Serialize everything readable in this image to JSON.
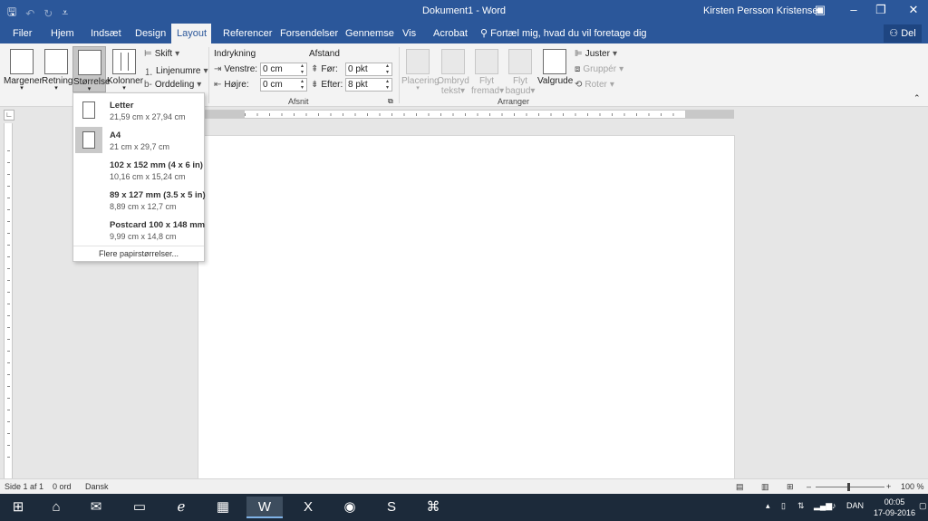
{
  "window": {
    "title": "Dokument1 - Word",
    "user": "Kirsten Persson Kristensen",
    "qat": {
      "save_icon": "save-icon",
      "undo_icon": "undo-icon",
      "redo_icon": "redo-icon",
      "customize_icon": "customize-icon"
    }
  },
  "tabs": [
    "Filer",
    "Hjem",
    "Indsæt",
    "Design",
    "Layout",
    "Referencer",
    "Forsendelser",
    "Gennemse",
    "Vis",
    "Acrobat"
  ],
  "active_tab": "Layout",
  "tell_me": "Fortæl mig, hvad du vil foretage dig",
  "share_label": "Del",
  "ribbon": {
    "page_setup": {
      "margins": "Margener",
      "orientation": "Retning",
      "size": "Størrelse",
      "columns": "Kolonner",
      "breaks": "Skift",
      "line_numbers": "Linjenumre",
      "hyphenation": "Orddeling"
    },
    "paragraph": {
      "label": "Afsnit",
      "indent": "Indrykning",
      "spacing": "Afstand",
      "left_label": "Venstre:",
      "left_value": "0 cm",
      "right_label": "Højre:",
      "right_value": "0 cm",
      "before_label": "Før:",
      "before_value": "0 pkt",
      "after_label": "Efter:",
      "after_value": "8 pkt"
    },
    "arrange": {
      "label": "Arranger",
      "position": "Placering",
      "wrap_text_1": "Ombryd",
      "wrap_text_2": "tekst",
      "bring_forward_1": "Flyt",
      "bring_forward_2": "fremad",
      "send_backward_1": "Flyt",
      "send_backward_2": "bagud",
      "selection_pane": "Valgrude",
      "align": "Juster",
      "group": "Gruppér",
      "rotate": "Roter"
    }
  },
  "size_menu": {
    "items": [
      {
        "name": "Letter",
        "dims": "21,59 cm x 27,94 cm"
      },
      {
        "name": "A4",
        "dims": "21 cm x 29,7 cm"
      },
      {
        "name": "102 x 152 mm (4 x 6 in)",
        "dims": "10,16 cm x 15,24 cm"
      },
      {
        "name": "89 x 127 mm (3.5 x 5 in)",
        "dims": "8,89 cm x 12,7 cm"
      },
      {
        "name": "Postcard 100 x 148 mm",
        "dims": "9,99 cm x 14,8 cm"
      }
    ],
    "selected_index": 1,
    "more": "Flere papirstørrelser..."
  },
  "ruler_numbers": [
    "1",
    "2",
    "1",
    "2",
    "3",
    "4",
    "5",
    "6",
    "7",
    "8",
    "9",
    "10",
    "11",
    "12",
    "13",
    "14",
    "15",
    "16",
    "18"
  ],
  "status": {
    "page": "Side 1 af 1",
    "words": "0 ord",
    "language": "Dansk",
    "zoom": "100 %"
  },
  "taskbar": {
    "language": "DAN",
    "time": "00:05",
    "date": "17-09-2016"
  },
  "colors": {
    "word_blue": "#2b579a",
    "taskbar": "#1c2a3a"
  }
}
